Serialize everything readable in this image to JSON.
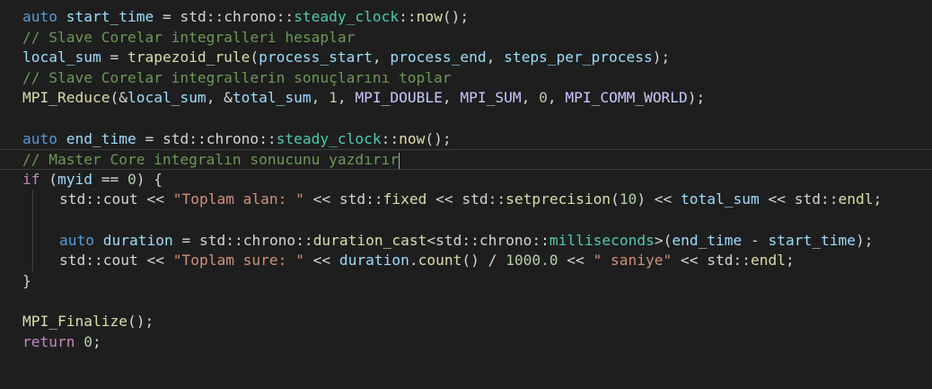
{
  "colors": {
    "background": "#1e1e1e",
    "keyword": "#569cd6",
    "control": "#c586c0",
    "function": "#dcdcaa",
    "variable": "#9cdcfe",
    "type": "#4ec9b0",
    "namespace": "#d4d4d4",
    "string": "#ce9178",
    "number": "#b5cea8",
    "comment": "#6a9955",
    "macro": "#c8c8ff",
    "plain": "#d4d4d4"
  },
  "lines": [
    {
      "tokens": [
        {
          "text": "auto",
          "kind": "keyword"
        },
        {
          "text": " ",
          "kind": "plain"
        },
        {
          "text": "start_time",
          "kind": "variable"
        },
        {
          "text": " = ",
          "kind": "plain"
        },
        {
          "text": "std",
          "kind": "namespace"
        },
        {
          "text": "::",
          "kind": "plain"
        },
        {
          "text": "chrono",
          "kind": "namespace"
        },
        {
          "text": "::",
          "kind": "plain"
        },
        {
          "text": "steady_clock",
          "kind": "type"
        },
        {
          "text": "::",
          "kind": "plain"
        },
        {
          "text": "now",
          "kind": "function"
        },
        {
          "text": "();",
          "kind": "plain"
        }
      ]
    },
    {
      "tokens": [
        {
          "text": "// Slave Corelar integralleri hesaplar",
          "kind": "comment"
        }
      ]
    },
    {
      "tokens": [
        {
          "text": "local_sum",
          "kind": "variable"
        },
        {
          "text": " = ",
          "kind": "plain"
        },
        {
          "text": "trapezoid_rule",
          "kind": "function"
        },
        {
          "text": "(",
          "kind": "plain"
        },
        {
          "text": "process_start",
          "kind": "variable"
        },
        {
          "text": ", ",
          "kind": "plain"
        },
        {
          "text": "process_end",
          "kind": "variable"
        },
        {
          "text": ", ",
          "kind": "plain"
        },
        {
          "text": "steps_per_process",
          "kind": "variable"
        },
        {
          "text": ");",
          "kind": "plain"
        }
      ]
    },
    {
      "tokens": [
        {
          "text": "// Slave Corelar integrallerin sonuçlarını toplar",
          "kind": "comment"
        }
      ]
    },
    {
      "tokens": [
        {
          "text": "MPI_Reduce",
          "kind": "function"
        },
        {
          "text": "(&",
          "kind": "plain"
        },
        {
          "text": "local_sum",
          "kind": "variable"
        },
        {
          "text": ", &",
          "kind": "plain"
        },
        {
          "text": "total_sum",
          "kind": "variable"
        },
        {
          "text": ", ",
          "kind": "plain"
        },
        {
          "text": "1",
          "kind": "number"
        },
        {
          "text": ", ",
          "kind": "plain"
        },
        {
          "text": "MPI_DOUBLE",
          "kind": "macro"
        },
        {
          "text": ", ",
          "kind": "plain"
        },
        {
          "text": "MPI_SUM",
          "kind": "macro"
        },
        {
          "text": ", ",
          "kind": "plain"
        },
        {
          "text": "0",
          "kind": "number"
        },
        {
          "text": ", ",
          "kind": "plain"
        },
        {
          "text": "MPI_COMM_WORLD",
          "kind": "macro"
        },
        {
          "text": ");",
          "kind": "plain"
        }
      ]
    },
    {
      "tokens": []
    },
    {
      "tokens": [
        {
          "text": "auto",
          "kind": "keyword"
        },
        {
          "text": " ",
          "kind": "plain"
        },
        {
          "text": "end_time",
          "kind": "variable"
        },
        {
          "text": " = ",
          "kind": "plain"
        },
        {
          "text": "std",
          "kind": "namespace"
        },
        {
          "text": "::",
          "kind": "plain"
        },
        {
          "text": "chrono",
          "kind": "namespace"
        },
        {
          "text": "::",
          "kind": "plain"
        },
        {
          "text": "steady_clock",
          "kind": "type"
        },
        {
          "text": "::",
          "kind": "plain"
        },
        {
          "text": "now",
          "kind": "function"
        },
        {
          "text": "();",
          "kind": "plain"
        }
      ]
    },
    {
      "current": true,
      "caret": true,
      "tokens": [
        {
          "text": "// Master Core integralın sonucunu yazdırır",
          "kind": "comment"
        }
      ]
    },
    {
      "tokens": [
        {
          "text": "if",
          "kind": "control"
        },
        {
          "text": " (",
          "kind": "plain"
        },
        {
          "text": "myid",
          "kind": "variable"
        },
        {
          "text": " == ",
          "kind": "plain"
        },
        {
          "text": "0",
          "kind": "number"
        },
        {
          "text": ") {",
          "kind": "plain"
        }
      ]
    },
    {
      "indent": true,
      "tokens": [
        {
          "text": "std",
          "kind": "namespace"
        },
        {
          "text": "::",
          "kind": "plain"
        },
        {
          "text": "cout",
          "kind": "namespace"
        },
        {
          "text": " << ",
          "kind": "plain"
        },
        {
          "text": "\"Toplam alan: \"",
          "kind": "string"
        },
        {
          "text": " << ",
          "kind": "plain"
        },
        {
          "text": "std",
          "kind": "namespace"
        },
        {
          "text": "::",
          "kind": "plain"
        },
        {
          "text": "fixed",
          "kind": "function"
        },
        {
          "text": " << ",
          "kind": "plain"
        },
        {
          "text": "std",
          "kind": "namespace"
        },
        {
          "text": "::",
          "kind": "plain"
        },
        {
          "text": "setprecision",
          "kind": "function"
        },
        {
          "text": "(",
          "kind": "plain"
        },
        {
          "text": "10",
          "kind": "number"
        },
        {
          "text": ") << ",
          "kind": "plain"
        },
        {
          "text": "total_sum",
          "kind": "variable"
        },
        {
          "text": " << ",
          "kind": "plain"
        },
        {
          "text": "std",
          "kind": "namespace"
        },
        {
          "text": "::",
          "kind": "plain"
        },
        {
          "text": "endl",
          "kind": "function"
        },
        {
          "text": ";",
          "kind": "plain"
        }
      ]
    },
    {
      "indent": true,
      "tokens": []
    },
    {
      "indent": true,
      "tokens": [
        {
          "text": "auto",
          "kind": "keyword"
        },
        {
          "text": " ",
          "kind": "plain"
        },
        {
          "text": "duration",
          "kind": "variable"
        },
        {
          "text": " = ",
          "kind": "plain"
        },
        {
          "text": "std",
          "kind": "namespace"
        },
        {
          "text": "::",
          "kind": "plain"
        },
        {
          "text": "chrono",
          "kind": "namespace"
        },
        {
          "text": "::",
          "kind": "plain"
        },
        {
          "text": "duration_cast",
          "kind": "function"
        },
        {
          "text": "<",
          "kind": "plain"
        },
        {
          "text": "std",
          "kind": "namespace"
        },
        {
          "text": "::",
          "kind": "plain"
        },
        {
          "text": "chrono",
          "kind": "namespace"
        },
        {
          "text": "::",
          "kind": "plain"
        },
        {
          "text": "milliseconds",
          "kind": "type"
        },
        {
          "text": ">(",
          "kind": "plain"
        },
        {
          "text": "end_time",
          "kind": "variable"
        },
        {
          "text": " - ",
          "kind": "plain"
        },
        {
          "text": "start_time",
          "kind": "variable"
        },
        {
          "text": ");",
          "kind": "plain"
        }
      ]
    },
    {
      "indent": true,
      "tokens": [
        {
          "text": "std",
          "kind": "namespace"
        },
        {
          "text": "::",
          "kind": "plain"
        },
        {
          "text": "cout",
          "kind": "namespace"
        },
        {
          "text": " << ",
          "kind": "plain"
        },
        {
          "text": "\"Toplam sure: \"",
          "kind": "string"
        },
        {
          "text": " << ",
          "kind": "plain"
        },
        {
          "text": "duration",
          "kind": "variable"
        },
        {
          "text": ".",
          "kind": "plain"
        },
        {
          "text": "count",
          "kind": "function"
        },
        {
          "text": "() / ",
          "kind": "plain"
        },
        {
          "text": "1000.0",
          "kind": "number"
        },
        {
          "text": " << ",
          "kind": "plain"
        },
        {
          "text": "\" saniye\"",
          "kind": "string"
        },
        {
          "text": " << ",
          "kind": "plain"
        },
        {
          "text": "std",
          "kind": "namespace"
        },
        {
          "text": "::",
          "kind": "plain"
        },
        {
          "text": "endl",
          "kind": "function"
        },
        {
          "text": ";",
          "kind": "plain"
        }
      ]
    },
    {
      "tokens": [
        {
          "text": "}",
          "kind": "plain"
        }
      ]
    },
    {
      "tokens": []
    },
    {
      "tokens": [
        {
          "text": "MPI_Finalize",
          "kind": "function"
        },
        {
          "text": "();",
          "kind": "plain"
        }
      ]
    },
    {
      "tokens": [
        {
          "text": "return",
          "kind": "control"
        },
        {
          "text": " ",
          "kind": "plain"
        },
        {
          "text": "0",
          "kind": "number"
        },
        {
          "text": ";",
          "kind": "plain"
        }
      ]
    }
  ]
}
